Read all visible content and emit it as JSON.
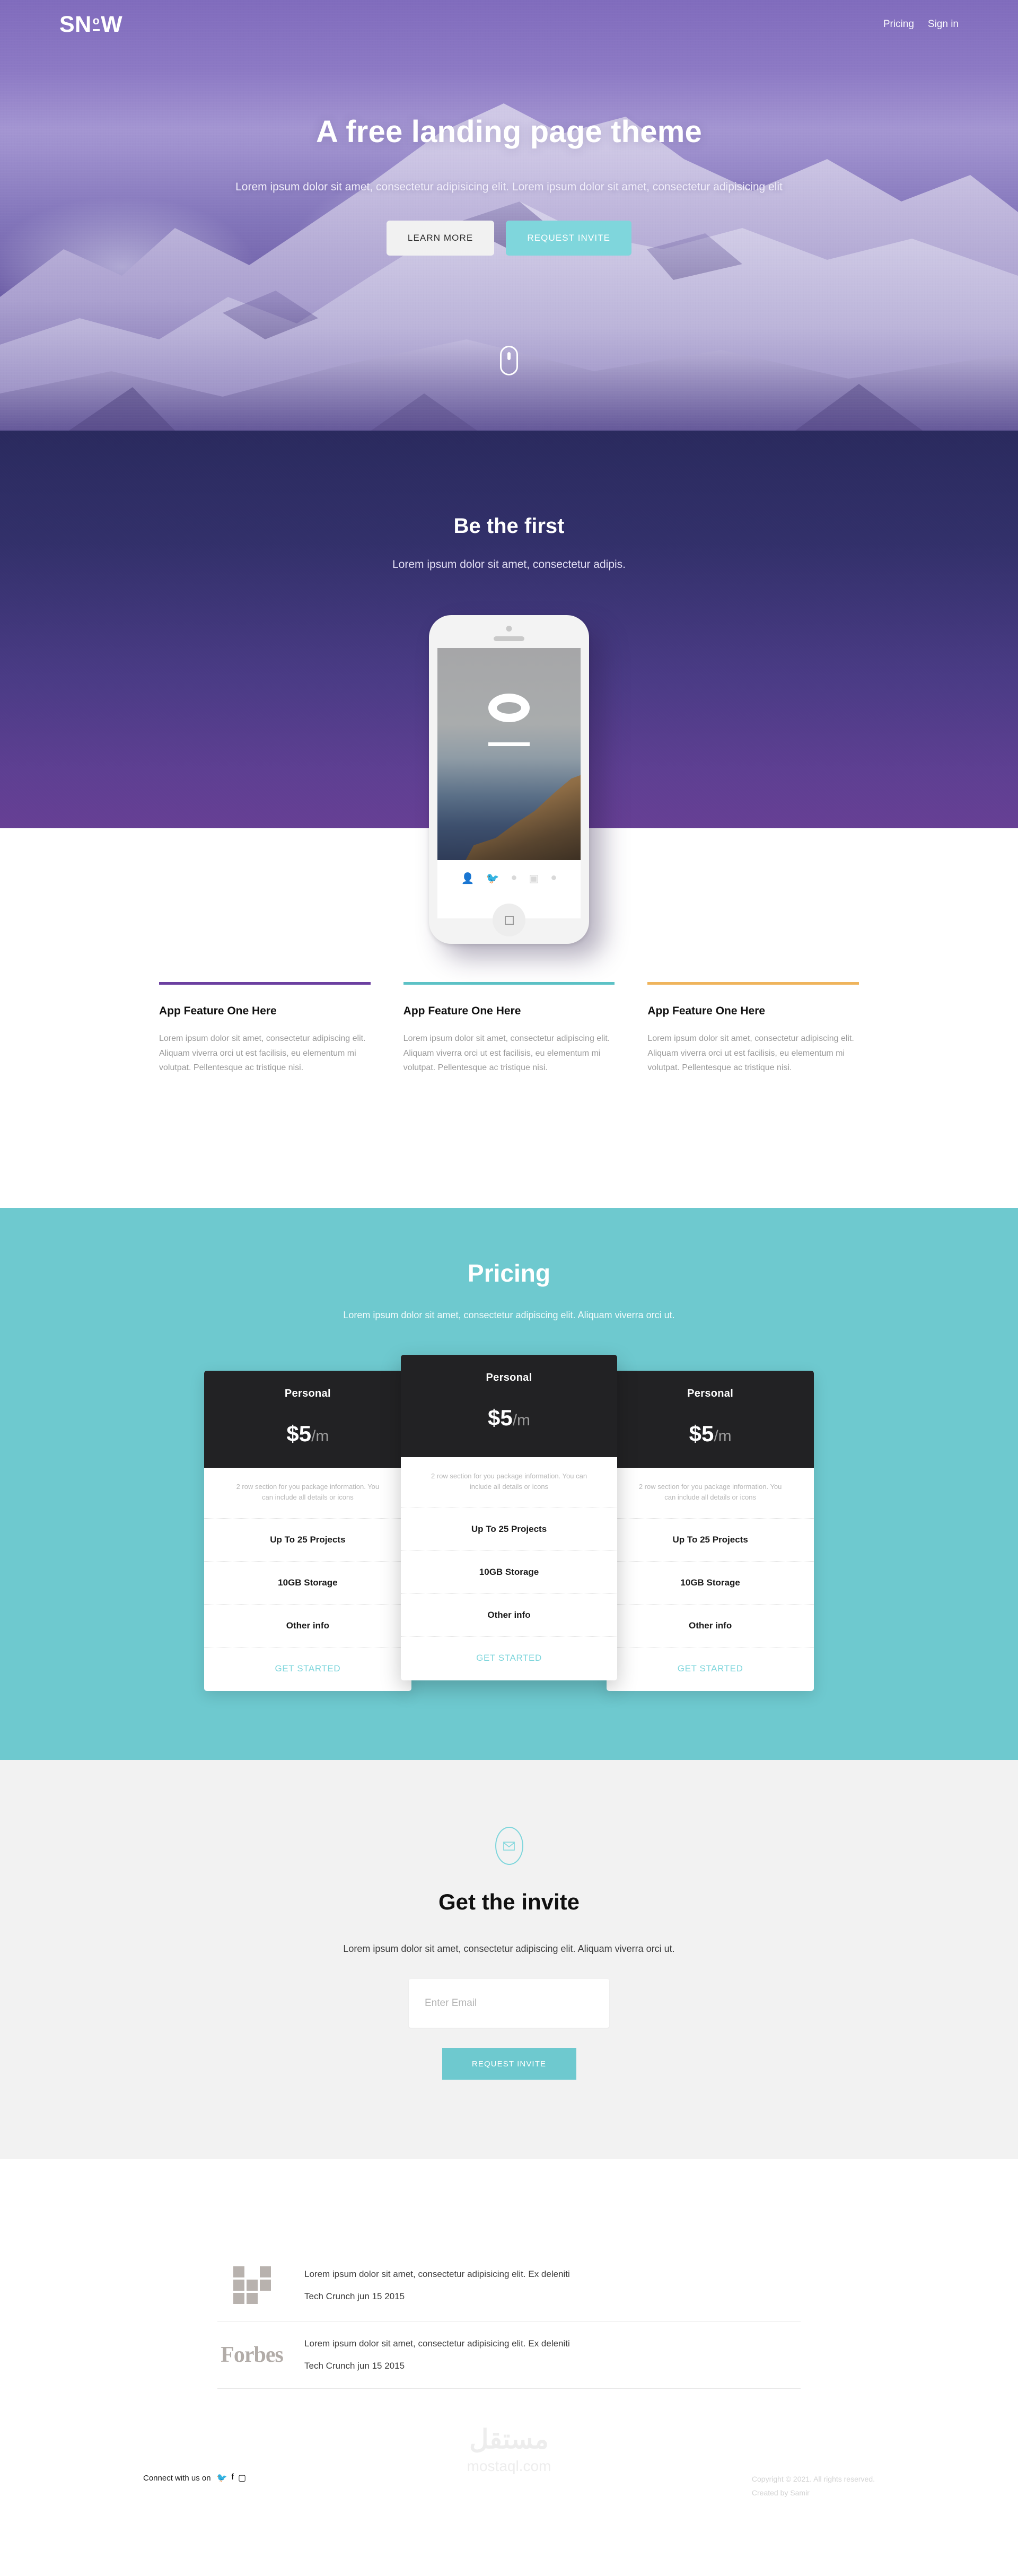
{
  "nav": {
    "logo_s": "SN",
    "logo_deg": "o",
    "logo_w": "W",
    "links": [
      {
        "label": "Pricing"
      },
      {
        "label": "Sign in"
      }
    ]
  },
  "hero": {
    "title": "A free landing page theme",
    "subtitle": "Lorem ipsum dolor sit amet, consectetur adipisicing elit. Lorem ipsum dolor sit amet, consectetur adipisicing elit",
    "btn_learn": "LEARN MORE",
    "btn_invite": "REQUEST INVITE",
    "scroll_icon": "mouse-scroll-icon"
  },
  "be_first": {
    "title": "Be the first",
    "subtitle": "Lorem ipsum dolor sit amet, consectetur adipis.",
    "phone_socials": [
      "user-icon",
      "twitter-icon",
      "facebook-icon",
      "instagram-icon",
      "skype-icon"
    ]
  },
  "features": [
    {
      "bar_color": "#6b3fa0",
      "title": "App Feature One Here",
      "text": "Lorem ipsum dolor sit amet, consectetur adipiscing elit. Aliquam viverra orci ut est facilisis, eu elementum mi volutpat. Pellentesque ac tristique nisi."
    },
    {
      "bar_color": "#5cc2c6",
      "title": "App Feature One Here",
      "text": "Lorem ipsum dolor sit amet, consectetur adipiscing elit. Aliquam viverra orci ut est facilisis, eu elementum mi volutpat. Pellentesque ac tristique nisi."
    },
    {
      "bar_color": "#efb45c",
      "title": "App Feature One Here",
      "text": "Lorem ipsum dolor sit amet, consectetur adipiscing elit. Aliquam viverra orci ut est facilisis, eu elementum mi volutpat. Pellentesque ac tristique nisi."
    }
  ],
  "pricing": {
    "title": "Pricing",
    "lead": "Lorem ipsum dolor sit amet, consectetur adipiscing elit. Aliquam viverra orci ut.",
    "accent": "#6ec9cf",
    "plans": [
      {
        "name": "Personal",
        "price": "$5",
        "per": "/m",
        "note": "2 row section for you package information. You can include all details or icons",
        "rows": [
          "Up To 25 Projects",
          "10GB Storage",
          "Other info"
        ],
        "cta": "GET STARTED"
      },
      {
        "name": "Personal",
        "price": "$5",
        "per": "/m",
        "note": "2 row section for you package information. You can include all details or icons",
        "rows": [
          "Up To 25 Projects",
          "10GB Storage",
          "Other info"
        ],
        "cta": "GET STARTED"
      },
      {
        "name": "Personal",
        "price": "$5",
        "per": "/m",
        "note": "2 row section for you package information. You can include all details or icons",
        "rows": [
          "Up To 25 Projects",
          "10GB Storage",
          "Other info"
        ],
        "cta": "GET STARTED"
      }
    ]
  },
  "invite": {
    "icon": "envelope-icon",
    "title": "Get the invite",
    "lead": "Lorem ipsum dolor sit amet, consectetur adipiscing elit. Aliquam viverra orci ut.",
    "email_placeholder": "Enter Email",
    "email_value": "",
    "button": "REQUEST INVITE"
  },
  "press": [
    {
      "logo": "techcrunch-logo",
      "quote": "Lorem ipsum dolor sit amet, consectetur adipisicing elit. Ex deleniti",
      "source": "Tech Crunch jun 15 2015"
    },
    {
      "logo": "forbes-logo",
      "logo_text": "Forbes",
      "quote": "Lorem ipsum dolor sit amet, consectetur adipisicing elit. Ex deleniti",
      "source": "Tech Crunch jun 15 2015"
    }
  ],
  "footer": {
    "watermark_ar": "مستقل",
    "watermark_domain": "mostaql.com",
    "connect_label": "Connect with us on",
    "socials": [
      "twitter-icon",
      "facebook-icon",
      "instagram-icon"
    ],
    "copyright": "Copyright © 2021. All rights reserved.",
    "credit": "Created by Samir"
  }
}
